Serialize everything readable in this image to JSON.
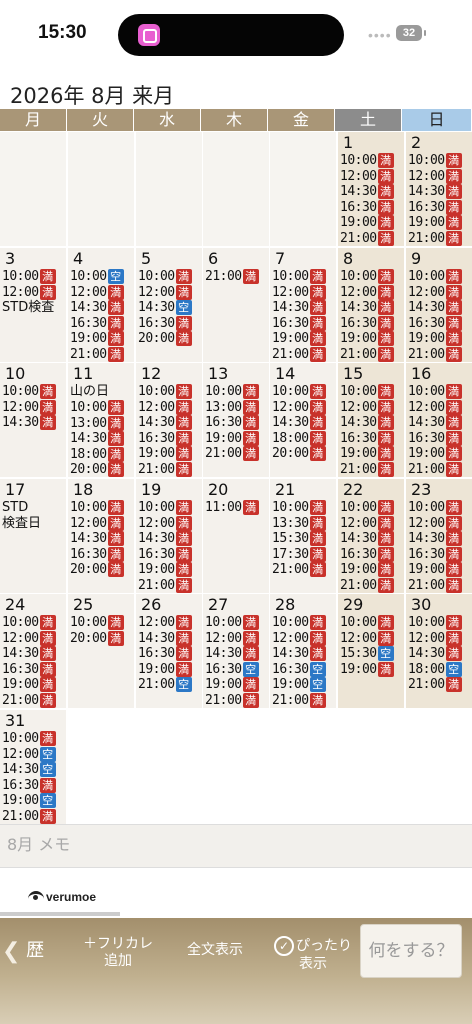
{
  "status": {
    "time": "15:30",
    "dots": "••••",
    "battery": "32"
  },
  "header": {
    "title": "2026年 8月 来月"
  },
  "weekdays": [
    "月",
    "火",
    "水",
    "木",
    "金",
    "土",
    "日"
  ],
  "days": [
    {
      "d": "1",
      "slots": [
        [
          "10:00",
          "満"
        ],
        [
          "12:00",
          "満"
        ],
        [
          "14:30",
          "満"
        ],
        [
          "16:30",
          "満"
        ],
        [
          "19:00",
          "満"
        ],
        [
          "21:00",
          "満"
        ]
      ]
    },
    {
      "d": "2",
      "slots": [
        [
          "10:00",
          "満"
        ],
        [
          "12:00",
          "満"
        ],
        [
          "14:30",
          "満"
        ],
        [
          "16:30",
          "満"
        ],
        [
          "19:00",
          "満"
        ],
        [
          "21:00",
          "満"
        ]
      ]
    },
    {
      "d": "3",
      "slots": [
        [
          "10:00",
          "満"
        ],
        [
          "12:00",
          "満"
        ]
      ],
      "note": "STD検査"
    },
    {
      "d": "4",
      "slots": [
        [
          "10:00",
          "空"
        ],
        [
          "12:00",
          "満"
        ],
        [
          "14:30",
          "満"
        ],
        [
          "16:30",
          "満"
        ],
        [
          "19:00",
          "満"
        ],
        [
          "21:00",
          "満"
        ]
      ]
    },
    {
      "d": "5",
      "slots": [
        [
          "10:00",
          "満"
        ],
        [
          "12:00",
          "満"
        ],
        [
          "14:30",
          "空"
        ],
        [
          "16:30",
          "満"
        ],
        [
          "20:00",
          "満"
        ]
      ]
    },
    {
      "d": "6",
      "slots": [
        [
          "21:00",
          "満"
        ]
      ]
    },
    {
      "d": "7",
      "slots": [
        [
          "10:00",
          "満"
        ],
        [
          "12:00",
          "満"
        ],
        [
          "14:30",
          "満"
        ],
        [
          "16:30",
          "満"
        ],
        [
          "19:00",
          "満"
        ],
        [
          "21:00",
          "満"
        ]
      ]
    },
    {
      "d": "8",
      "slots": [
        [
          "10:00",
          "満"
        ],
        [
          "12:00",
          "満"
        ],
        [
          "14:30",
          "満"
        ],
        [
          "16:30",
          "満"
        ],
        [
          "19:00",
          "満"
        ],
        [
          "21:00",
          "満"
        ]
      ]
    },
    {
      "d": "9",
      "slots": [
        [
          "10:00",
          "満"
        ],
        [
          "12:00",
          "満"
        ],
        [
          "14:30",
          "満"
        ],
        [
          "16:30",
          "満"
        ],
        [
          "19:00",
          "満"
        ],
        [
          "21:00",
          "満"
        ]
      ]
    },
    {
      "d": "10",
      "slots": [
        [
          "10:00",
          "満"
        ],
        [
          "12:00",
          "満"
        ],
        [
          "14:30",
          "満"
        ]
      ]
    },
    {
      "d": "11",
      "note": "山の日",
      "slots": [
        [
          "10:00",
          "満"
        ],
        [
          "13:00",
          "満"
        ],
        [
          "14:30",
          "満"
        ],
        [
          "18:00",
          "満"
        ],
        [
          "20:00",
          "満"
        ]
      ]
    },
    {
      "d": "12",
      "slots": [
        [
          "10:00",
          "満"
        ],
        [
          "12:00",
          "満"
        ],
        [
          "14:30",
          "満"
        ],
        [
          "16:30",
          "満"
        ],
        [
          "19:00",
          "満"
        ],
        [
          "21:00",
          "満"
        ]
      ]
    },
    {
      "d": "13",
      "slots": [
        [
          "10:00",
          "満"
        ],
        [
          "13:00",
          "満"
        ],
        [
          "16:30",
          "満"
        ],
        [
          "19:00",
          "満"
        ],
        [
          "21:00",
          "満"
        ]
      ]
    },
    {
      "d": "14",
      "slots": [
        [
          "10:00",
          "満"
        ],
        [
          "12:00",
          "満"
        ],
        [
          "14:30",
          "満"
        ],
        [
          "18:00",
          "満"
        ],
        [
          "20:00",
          "満"
        ]
      ]
    },
    {
      "d": "15",
      "slots": [
        [
          "10:00",
          "満"
        ],
        [
          "12:00",
          "満"
        ],
        [
          "14:30",
          "満"
        ],
        [
          "16:30",
          "満"
        ],
        [
          "19:00",
          "満"
        ],
        [
          "21:00",
          "満"
        ]
      ]
    },
    {
      "d": "16",
      "slots": [
        [
          "10:00",
          "満"
        ],
        [
          "12:00",
          "満"
        ],
        [
          "14:30",
          "満"
        ],
        [
          "16:30",
          "満"
        ],
        [
          "19:00",
          "満"
        ],
        [
          "21:00",
          "満"
        ]
      ]
    },
    {
      "d": "17",
      "slots": [],
      "note": "STD\n検査日"
    },
    {
      "d": "18",
      "slots": [
        [
          "10:00",
          "満"
        ],
        [
          "12:00",
          "満"
        ],
        [
          "14:30",
          "満"
        ],
        [
          "16:30",
          "満"
        ],
        [
          "20:00",
          "満"
        ]
      ]
    },
    {
      "d": "19",
      "slots": [
        [
          "10:00",
          "満"
        ],
        [
          "12:00",
          "満"
        ],
        [
          "14:30",
          "満"
        ],
        [
          "16:30",
          "満"
        ],
        [
          "19:00",
          "満"
        ],
        [
          "21:00",
          "満"
        ]
      ]
    },
    {
      "d": "20",
      "slots": [
        [
          "11:00",
          "満"
        ]
      ]
    },
    {
      "d": "21",
      "slots": [
        [
          "10:00",
          "満"
        ],
        [
          "13:30",
          "満"
        ],
        [
          "15:30",
          "満"
        ],
        [
          "17:30",
          "満"
        ],
        [
          "21:00",
          "満"
        ]
      ]
    },
    {
      "d": "22",
      "slots": [
        [
          "10:00",
          "満"
        ],
        [
          "12:00",
          "満"
        ],
        [
          "14:30",
          "満"
        ],
        [
          "16:30",
          "満"
        ],
        [
          "19:00",
          "満"
        ],
        [
          "21:00",
          "満"
        ]
      ]
    },
    {
      "d": "23",
      "slots": [
        [
          "10:00",
          "満"
        ],
        [
          "12:00",
          "満"
        ],
        [
          "14:30",
          "満"
        ],
        [
          "16:30",
          "満"
        ],
        [
          "19:00",
          "満"
        ],
        [
          "21:00",
          "満"
        ]
      ]
    },
    {
      "d": "24",
      "slots": [
        [
          "10:00",
          "満"
        ],
        [
          "12:00",
          "満"
        ],
        [
          "14:30",
          "満"
        ],
        [
          "16:30",
          "満"
        ],
        [
          "19:00",
          "満"
        ],
        [
          "21:00",
          "満"
        ]
      ]
    },
    {
      "d": "25",
      "slots": [
        [
          "10:00",
          "満"
        ],
        [
          "20:00",
          "満"
        ]
      ]
    },
    {
      "d": "26",
      "slots": [
        [
          "12:00",
          "満"
        ],
        [
          "14:30",
          "満"
        ],
        [
          "16:30",
          "満"
        ],
        [
          "19:00",
          "満"
        ],
        [
          "21:00",
          "空"
        ]
      ]
    },
    {
      "d": "27",
      "slots": [
        [
          "10:00",
          "満"
        ],
        [
          "12:00",
          "満"
        ],
        [
          "14:30",
          "満"
        ],
        [
          "16:30",
          "空"
        ],
        [
          "19:00",
          "満"
        ],
        [
          "21:00",
          "満"
        ]
      ]
    },
    {
      "d": "28",
      "slots": [
        [
          "10:00",
          "満"
        ],
        [
          "12:00",
          "満"
        ],
        [
          "14:30",
          "満"
        ],
        [
          "16:30",
          "空"
        ],
        [
          "19:00",
          "空"
        ],
        [
          "21:00",
          "満"
        ]
      ]
    },
    {
      "d": "29",
      "slots": [
        [
          "10:00",
          "満"
        ],
        [
          "12:00",
          "満"
        ],
        [
          "15:30",
          "空"
        ],
        [
          "19:00",
          "満"
        ]
      ]
    },
    {
      "d": "30",
      "slots": [
        [
          "10:00",
          "満"
        ],
        [
          "12:00",
          "満"
        ],
        [
          "14:30",
          "満"
        ],
        [
          "18:00",
          "空"
        ],
        [
          "21:00",
          "満"
        ]
      ]
    },
    {
      "d": "31",
      "slots": [
        [
          "10:00",
          "満"
        ],
        [
          "12:00",
          "空"
        ],
        [
          "14:30",
          "空"
        ],
        [
          "16:30",
          "満"
        ],
        [
          "19:00",
          "空"
        ],
        [
          "21:00",
          "満"
        ]
      ]
    }
  ],
  "memo": {
    "placeholder": "8月 メモ"
  },
  "logo": {
    "text": "verumoe"
  },
  "toolbar": {
    "back": "歴",
    "furigana_line1": "＋フリカレ",
    "furigana_line2": "追加",
    "fulltext": "全文表示",
    "pitta_line1": "ぴったり",
    "pitta_line2": "表示",
    "action": "何をする？"
  },
  "colors": {
    "full": "#c8322b",
    "free": "#2c78c6",
    "header_bar": "#a99677",
    "sunday": "#a9cbe8"
  }
}
